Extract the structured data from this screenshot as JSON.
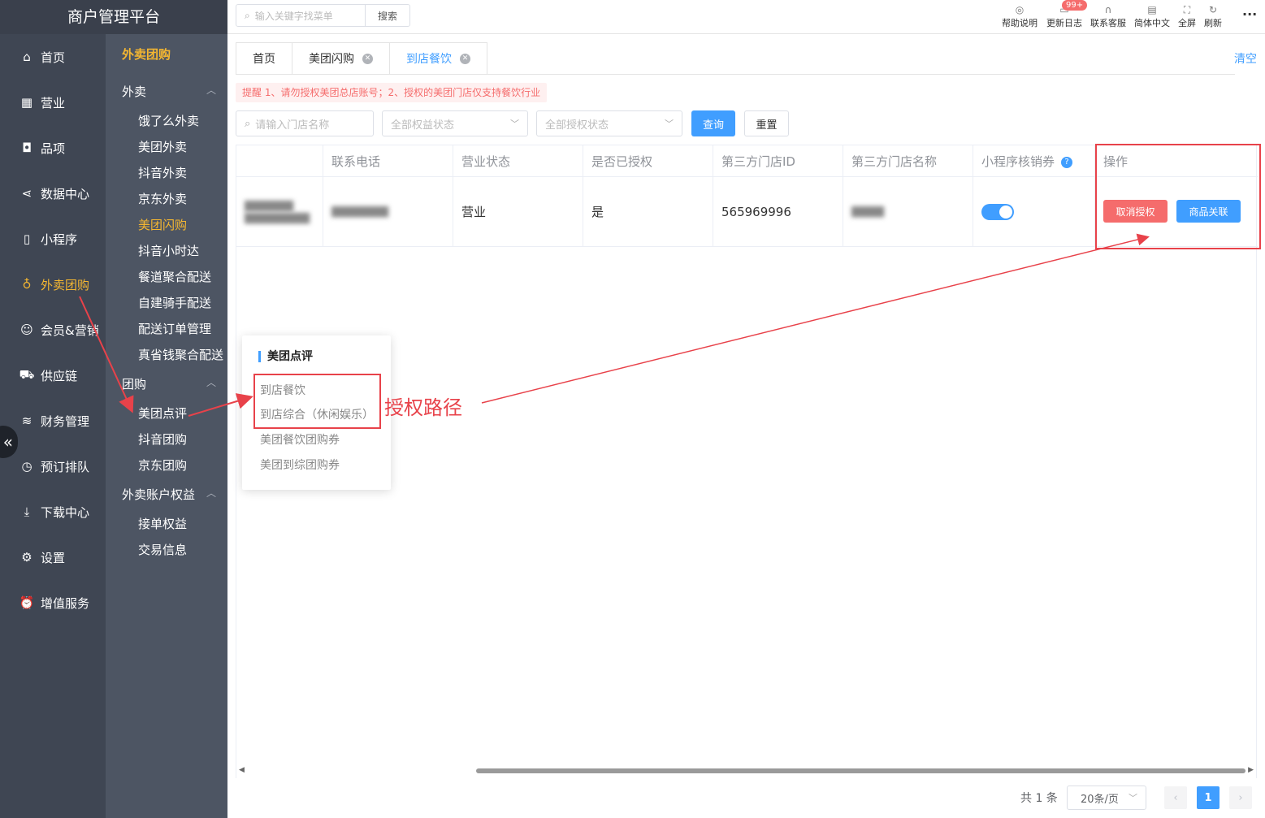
{
  "app": {
    "brand": "商户管理平台"
  },
  "nav": [
    {
      "label": "首页",
      "icon": "home-icon"
    },
    {
      "label": "营业",
      "icon": "calendar-icon"
    },
    {
      "label": "品项",
      "icon": "bag-icon"
    },
    {
      "label": "数据中心",
      "icon": "share-icon"
    },
    {
      "label": "小程序",
      "icon": "phone-icon"
    },
    {
      "label": "外卖团购",
      "icon": "bike-icon",
      "active": true
    },
    {
      "label": "会员&营销",
      "icon": "user-icon"
    },
    {
      "label": "供应链",
      "icon": "truck-icon"
    },
    {
      "label": "财务管理",
      "icon": "database-icon"
    },
    {
      "label": "预订排队",
      "icon": "clock-icon"
    },
    {
      "label": "下载中心",
      "icon": "download-icon"
    },
    {
      "label": "设置",
      "icon": "gear-icon"
    },
    {
      "label": "增值服务",
      "icon": "alarm-icon"
    }
  ],
  "subnav": {
    "title": "外卖团购",
    "groups": [
      {
        "label": "外卖",
        "items": [
          "饿了么外卖",
          "美团外卖",
          "抖音外卖",
          "京东外卖",
          "美团闪购",
          "抖音小时达",
          "餐道聚合配送",
          "自建骑手配送",
          "配送订单管理",
          "真省钱聚合配送"
        ]
      },
      {
        "label": "团购",
        "items": [
          "美团点评",
          "抖音团购",
          "京东团购"
        ]
      },
      {
        "label": "外卖账户权益",
        "items": [
          "接单权益",
          "交易信息"
        ]
      }
    ],
    "active_item": "美团闪购"
  },
  "topbar": {
    "search_placeholder": "输入关键字找菜单",
    "search_button": "搜索",
    "tools": [
      "帮助说明",
      "更新日志",
      "联系客服",
      "简体中文",
      "全屏",
      "刷新"
    ],
    "badge": "99+"
  },
  "tabs": [
    {
      "label": "首页",
      "closable": false
    },
    {
      "label": "美团闪购",
      "closable": true
    },
    {
      "label": "到店餐饮",
      "closable": true,
      "active": true
    }
  ],
  "clear_label": "清空",
  "notice": "提醒 1、请勿授权美团总店账号；2、授权的美团门店仅支持餐饮行业",
  "filters": {
    "store_placeholder": "请输入门店名称",
    "rights_status": "全部权益状态",
    "auth_status": "全部授权状态",
    "query": "查询",
    "reset": "重置"
  },
  "table": {
    "columns": [
      "",
      "联系电话",
      "营业状态",
      "是否已授权",
      "第三方门店ID",
      "第三方门店名称",
      "小程序核销券",
      "操作"
    ],
    "rows": [
      {
        "store": "▇▇▇▇▇▇",
        "store_sub": "▇▇▇▇▇▇▇▇",
        "phone": "▇▇▇▇▇▇▇",
        "status": "营业",
        "authorized": "是",
        "third_id": "565969996",
        "third_name": "▇▇▇▇",
        "coupon_enabled": true,
        "actions": [
          "取消授权",
          "商品关联"
        ]
      }
    ]
  },
  "pagination": {
    "total": "共 1 条",
    "page_size": "20条/页",
    "current": "1"
  },
  "popover": {
    "title": "美团点评",
    "items": [
      "到店餐饮",
      "到店综合（休闲娱乐）",
      "美团餐饮团购券",
      "美团到综团购券"
    ]
  },
  "annotation": {
    "label": "授权路径",
    "color": "#e8424a"
  }
}
